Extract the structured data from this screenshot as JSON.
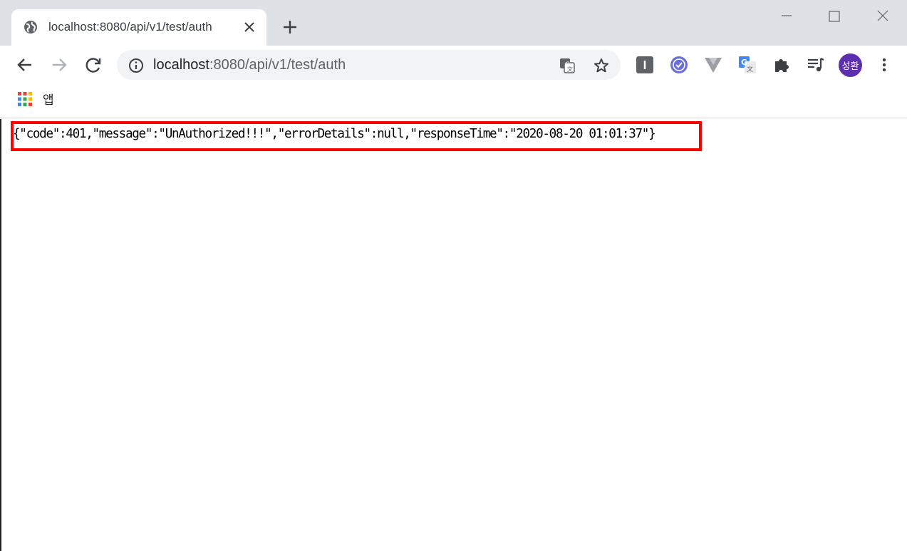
{
  "tab": {
    "title": "localhost:8080/api/v1/test/auth"
  },
  "omnibox": {
    "host": "localhost",
    "rest": ":8080/api/v1/test/auth"
  },
  "bookmarks": {
    "apps_label": "앱"
  },
  "profile": {
    "initials": "성환",
    "color": "#5b2fb0"
  },
  "icons": {
    "tab_favicon": "globe-icon",
    "tab_close": "close-icon",
    "new_tab": "plus-icon",
    "back": "back-arrow-icon",
    "forward": "forward-arrow-icon",
    "reload": "reload-icon",
    "site_info": "info-icon",
    "translate": "translate-icon",
    "bookmark_star": "star-icon",
    "extensions": [
      "i-extension-icon",
      "check-extension-icon",
      "vue-devtools-icon",
      "google-translate-icon",
      "puzzle-icon",
      "media-queue-icon"
    ],
    "menu": "kebab-menu-icon"
  },
  "page": {
    "json_text": "{\"code\":401,\"message\":\"UnAuthorized!!!\",\"errorDetails\":null,\"responseTime\":\"2020-08-20 01:01:37\"}"
  },
  "annotation": {
    "color": "#ff0000"
  }
}
